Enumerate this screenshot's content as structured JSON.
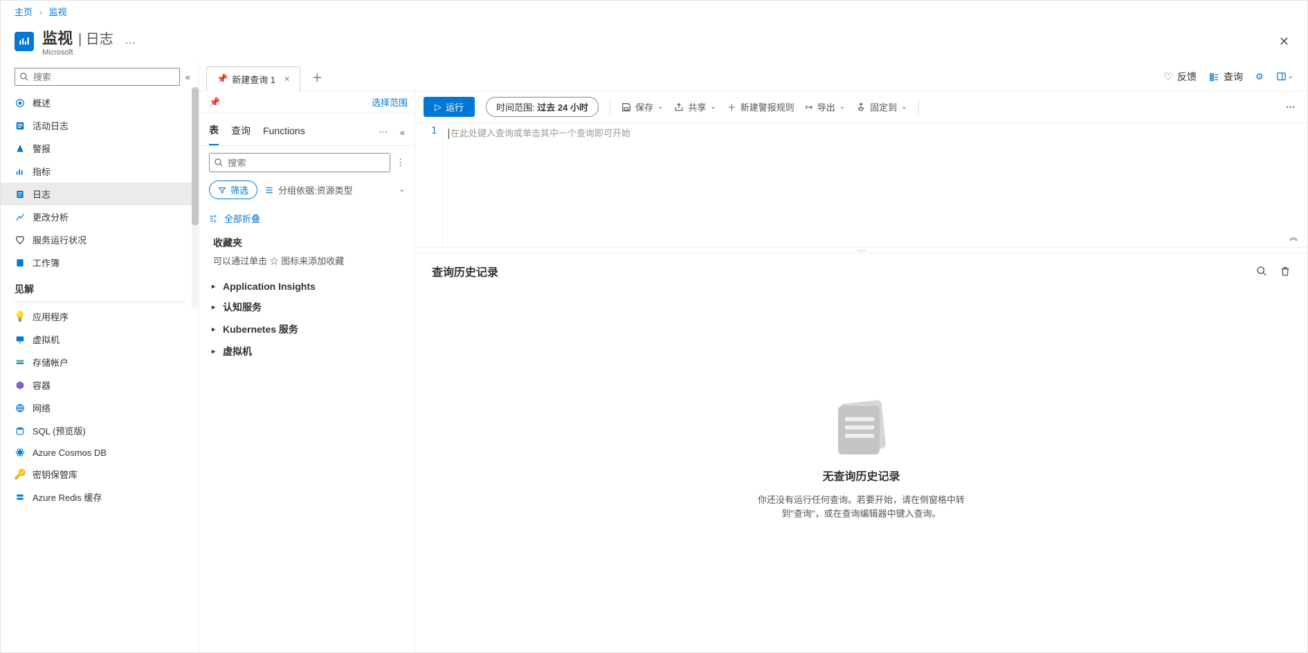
{
  "breadcrumb": {
    "home": "主页",
    "current": "监视"
  },
  "header": {
    "title": "监视",
    "subtitle": "日志",
    "vendor": "Microsoft",
    "dots": "…"
  },
  "sidebar": {
    "search_placeholder": "搜索",
    "items": [
      {
        "icon": "overview",
        "label": "概述"
      },
      {
        "icon": "activity",
        "label": "活动日志"
      },
      {
        "icon": "alerts",
        "label": "警报"
      },
      {
        "icon": "metrics",
        "label": "指标"
      },
      {
        "icon": "logs",
        "label": "日志",
        "active": true
      },
      {
        "icon": "change",
        "label": "更改分析"
      },
      {
        "icon": "health",
        "label": "服务运行状况"
      },
      {
        "icon": "workbooks",
        "label": "工作簿"
      }
    ],
    "insights_heading": "见解",
    "insights": [
      {
        "icon": "bulb-purple",
        "label": "应用程序"
      },
      {
        "icon": "vm",
        "label": "虚拟机"
      },
      {
        "icon": "storage",
        "label": "存储帐户"
      },
      {
        "icon": "containers",
        "label": "容器"
      },
      {
        "icon": "network",
        "label": "网络"
      },
      {
        "icon": "sql",
        "label": "SQL (预览版)"
      },
      {
        "icon": "cosmos",
        "label": "Azure Cosmos DB"
      },
      {
        "icon": "key",
        "label": "密钥保管库"
      },
      {
        "icon": "redis",
        "label": "Azure Redis 缓存"
      }
    ]
  },
  "tabs": {
    "new_query": "新建查询 1"
  },
  "scope": {
    "select_scope": "选择范围"
  },
  "mid_tabs": {
    "tables": "表",
    "queries": "查询",
    "functions": "Functions"
  },
  "mid_search_placeholder": "搜索",
  "mid_filter": {
    "filter": "筛选",
    "group_prefix": "分组依据:",
    "group_value": "资源类型"
  },
  "collapse_all": "全部折叠",
  "favorites": {
    "title": "收藏夹",
    "hint_prefix": "可以通过单击 ",
    "hint_star": "☆",
    "hint_suffix": " 图标来添加收藏"
  },
  "tree": [
    {
      "label": "Application Insights"
    },
    {
      "label": "认知服务"
    },
    {
      "label": "Kubernetes 服务"
    },
    {
      "label": "虚拟机"
    }
  ],
  "top_actions": {
    "feedback": "反馈",
    "queries": "查询"
  },
  "toolbar": {
    "run": "运行",
    "time_label": "时间范围:",
    "time_value": "过去 24 小时",
    "save": "保存",
    "share": "共享",
    "new_alert": "新建警报规则",
    "export": "导出",
    "pin": "固定到"
  },
  "editor": {
    "line_number": "1",
    "placeholder": "在此处键入查询或单击其中一个查询即可开始"
  },
  "history": {
    "title": "查询历史记录",
    "empty_title": "无查询历史记录",
    "empty_body": "你还没有运行任何查询。若要开始，请在侧窗格中转到\"查询\"，或在查询编辑器中键入查询。"
  }
}
